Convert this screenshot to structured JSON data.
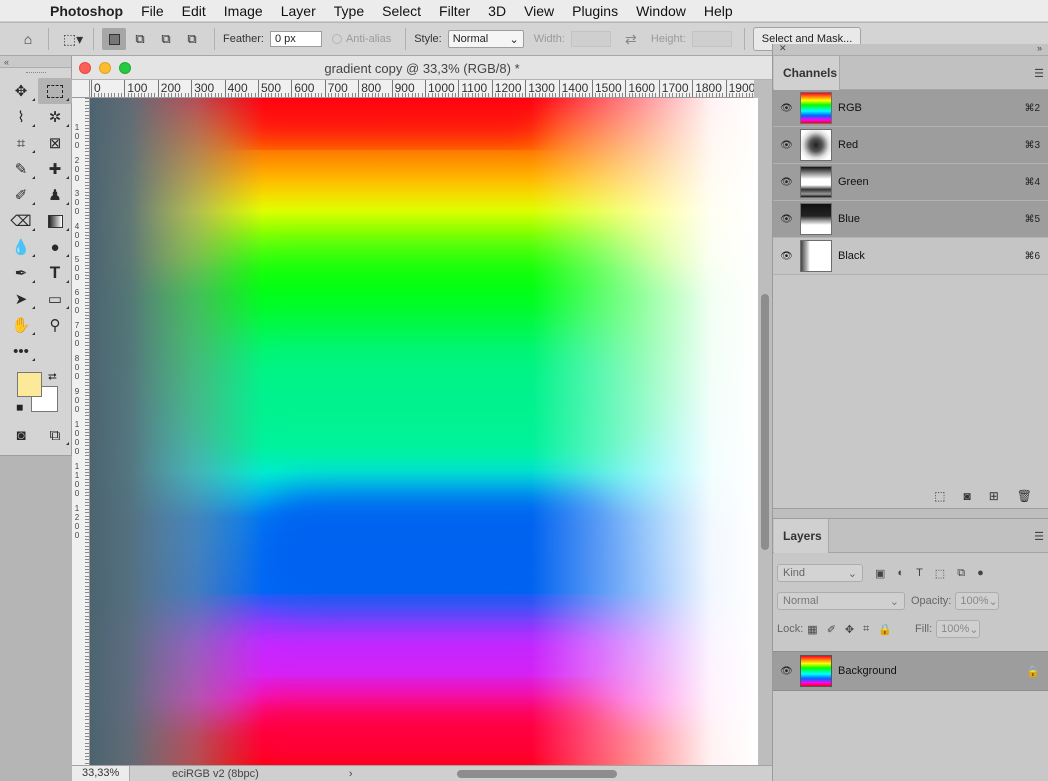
{
  "menubar": {
    "app_name": "Photoshop",
    "items": [
      "File",
      "Edit",
      "Image",
      "Layer",
      "Type",
      "Select",
      "Filter",
      "3D",
      "View",
      "Plugins",
      "Window",
      "Help"
    ]
  },
  "options_bar": {
    "feather_label": "Feather:",
    "feather_value": "0 px",
    "antialias_label": "Anti-alias",
    "style_label": "Style:",
    "style_value": "Normal",
    "width_label": "Width:",
    "height_label": "Height:",
    "select_mask_label": "Select and Mask..."
  },
  "document": {
    "title": "gradient copy @ 33,3% (RGB/8) *",
    "ruler_labels": [
      "0",
      "100",
      "200",
      "300",
      "400",
      "500",
      "600",
      "700",
      "800",
      "900",
      "1000",
      "1100",
      "1200",
      "1300",
      "1400",
      "1500",
      "1600",
      "1700",
      "1800",
      "1900"
    ],
    "vruler_labels": [
      "1",
      "0",
      "0",
      "2",
      "0",
      "0",
      "3",
      "0",
      "0",
      "4",
      "0",
      "0",
      "5",
      "0",
      "0",
      "6",
      "0",
      "0",
      "7",
      "0",
      "0",
      "8",
      "0",
      "0",
      "9",
      "0",
      "0",
      "1",
      "0",
      "0",
      "0",
      "1",
      "1",
      "0",
      "0",
      "1",
      "2",
      "0",
      "0"
    ],
    "zoom": "33,33%",
    "profile": "eciRGB v2 (8bpc)",
    "status_arrow": "›"
  },
  "channels": {
    "tab_label": "Channels",
    "rows": [
      {
        "name": "RGB",
        "shortcut": "⌘2"
      },
      {
        "name": "Red",
        "shortcut": "⌘3"
      },
      {
        "name": "Green",
        "shortcut": "⌘4"
      },
      {
        "name": "Blue",
        "shortcut": "⌘5"
      },
      {
        "name": "Black",
        "shortcut": "⌘6"
      }
    ]
  },
  "layers": {
    "tab_label": "Layers",
    "kind_label": "Kind",
    "blend_mode": "Normal",
    "opacity_label": "Opacity:",
    "opacity_value": "100%",
    "lock_label": "Lock:",
    "fill_label": "Fill:",
    "fill_value": "100%",
    "layer_name": "Background"
  },
  "colors": {
    "foreground": "#fde99a",
    "background": "#ffffff"
  }
}
